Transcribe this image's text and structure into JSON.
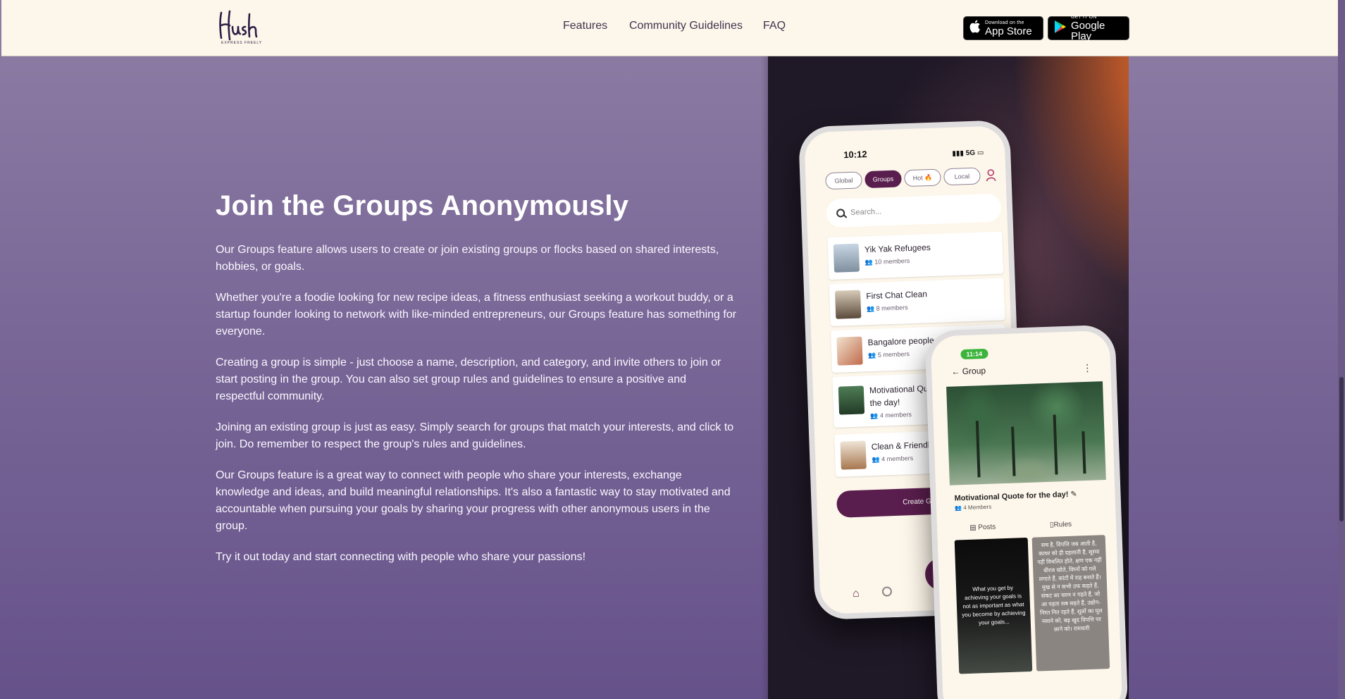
{
  "header": {
    "logo_text": "Hush",
    "logo_tagline": "EXPRESS FREELY",
    "nav": [
      "Features",
      "Community Guidelines",
      "FAQ"
    ],
    "app_store": {
      "small": "Download on the",
      "big": "App Store"
    },
    "google_play": {
      "small": "GET IT ON",
      "big": "Google Play"
    }
  },
  "main": {
    "title": "Join the Groups Anonymously",
    "paragraphs": [
      "Our Groups feature allows users to create or join existing groups or flocks based on shared interests, hobbies, or goals.",
      "Whether you're a foodie looking for new recipe ideas, a fitness enthusiast seeking a workout buddy, or a startup founder looking to network with like-minded entrepreneurs, our Groups feature has something for everyone.",
      "Creating a group is simple - just choose a name, description, and category, and invite others to join or start posting in the group. You can also set group rules and guidelines to ensure a positive and respectful community.",
      "Joining an existing group is just as easy. Simply search for groups that match your interests, and click to join. Do remember to respect the group's rules and guidelines.",
      "Our Groups feature is a great way to connect with people who share your interests, exchange knowledge and ideas, and build meaningful relationships. It's also a fantastic way to stay motivated and accountable when pursuing your goals by sharing your progress with other anonymous users in the group.",
      "Try it out today and start connecting with people who share your passions!"
    ]
  },
  "phone1": {
    "time": "10:12",
    "signal": "5G",
    "tabs": [
      "Global",
      "Groups",
      "Hot 🔥",
      "Local"
    ],
    "search_placeholder": "Search...",
    "groups": [
      {
        "name": "Yik Yak Refugees",
        "members": "10 members",
        "thumb_color": "#9fb2c8"
      },
      {
        "name": "First Chat Clean",
        "members": "8 members",
        "thumb_color": "#7a6a5a"
      },
      {
        "name": "Bangalore people",
        "members": "5 members",
        "thumb_color": "#d9b48e"
      },
      {
        "name": "Motivational Quote for the day!",
        "members": "4 members",
        "thumb_color": "#3e6a45"
      },
      {
        "name": "Clean & Friendly Chat",
        "members": "4 members",
        "thumb_color": "#c9a07a"
      }
    ],
    "create_button": "Create Group"
  },
  "phone2": {
    "time": "11:14",
    "header": "Group",
    "group_title": "Motivational Quote for the day!",
    "members": "4 Members",
    "tab_posts": "Posts",
    "tab_rules": "Rules",
    "post1_text": "What you get by achieving your goals is not as important as what you become by achieving your goals...",
    "post2_text": "सच है, विपत्ति जब आती है, कायर को ही दहलाती है, सूरमा नहीं विचलित होते, क्षण एक नहीं धीरज खोते, विघ्नों को गले लगाते हैं, कांटों में राह बनाते हैं। मुख से न कभी उफ कहते हैं, संकट का चरण न गहते हैं, जो आ पड़ता सब सहते हैं, उद्योग-निरत नित रहते हैं, शूलों का मूल नसाने को, बढ़ खुद विपत्ति पर छाने को। रामधारी"
  }
}
